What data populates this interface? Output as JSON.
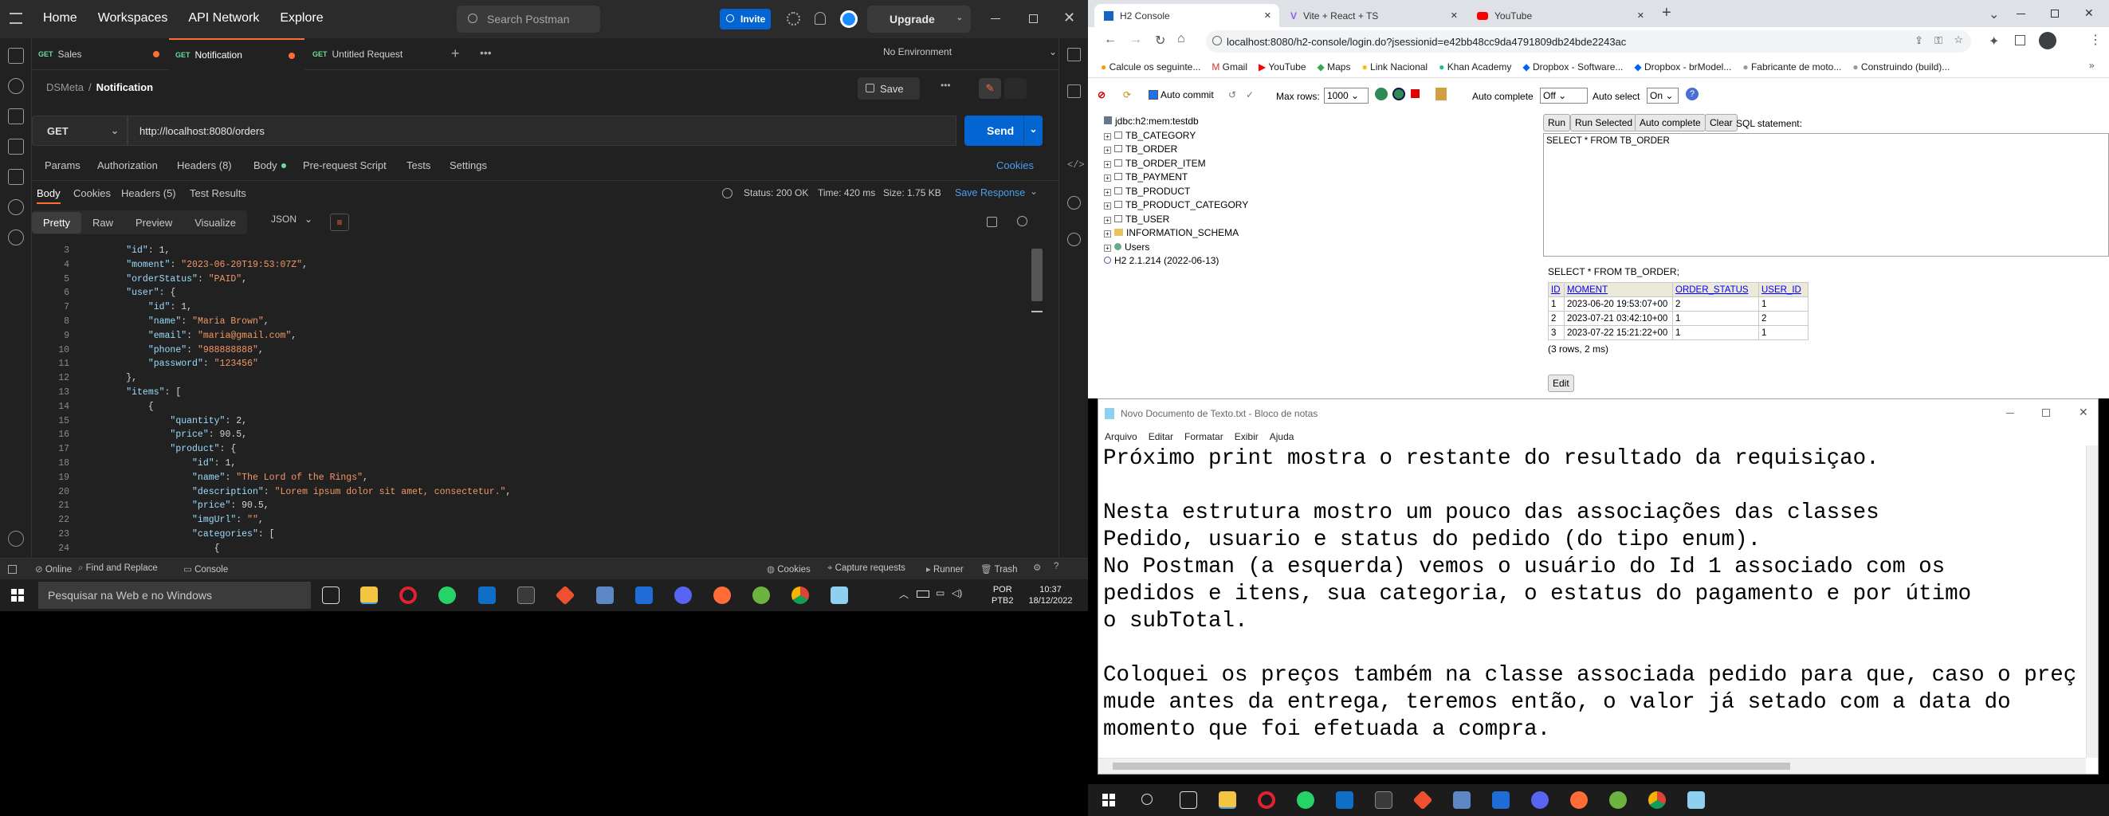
{
  "postman": {
    "nav": [
      "Home",
      "Workspaces",
      "API Network",
      "Explore"
    ],
    "search_placeholder": "Search Postman",
    "invite": "Invite",
    "upgrade": "Upgrade",
    "tabs": [
      {
        "method": "GET",
        "name": "Sales"
      },
      {
        "method": "GET",
        "name": "Notification"
      },
      {
        "method": "GET",
        "name": "Untitled Request"
      }
    ],
    "environment": "No Environment",
    "breadcrumb_parent": "DSMeta",
    "breadcrumb_current": "Notification",
    "save": "Save",
    "method": "GET",
    "url": "http://localhost:8080/orders",
    "send": "Send",
    "request_tabs": [
      "Params",
      "Authorization",
      "Headers (8)",
      "Body",
      "Pre-request Script",
      "Tests",
      "Settings"
    ],
    "cookies": "Cookies",
    "response_tabs": [
      "Body",
      "Cookies",
      "Headers (5)",
      "Test Results"
    ],
    "status": "Status: 200 OK",
    "time": "Time: 420 ms",
    "size": "Size: 1.75 KB",
    "save_response": "Save Response",
    "format_tabs": [
      "Pretty",
      "Raw",
      "Preview",
      "Visualize"
    ],
    "format": "JSON",
    "code_lines": [
      {
        "n": "3",
        "t": "        \"id\": 1,"
      },
      {
        "n": "4",
        "t": "        \"moment\": \"2023-06-20T19:53:07Z\","
      },
      {
        "n": "5",
        "t": "        \"orderStatus\": \"PAID\","
      },
      {
        "n": "6",
        "t": "        \"user\": {"
      },
      {
        "n": "7",
        "t": "            \"id\": 1,"
      },
      {
        "n": "8",
        "t": "            \"name\": \"Maria Brown\","
      },
      {
        "n": "9",
        "t": "            \"email\": \"maria@gmail.com\","
      },
      {
        "n": "10",
        "t": "            \"phone\": \"988888888\","
      },
      {
        "n": "11",
        "t": "            \"password\": \"123456\""
      },
      {
        "n": "12",
        "t": "        },"
      },
      {
        "n": "13",
        "t": "        \"items\": ["
      },
      {
        "n": "14",
        "t": "            {"
      },
      {
        "n": "15",
        "t": "                \"quantity\": 2,"
      },
      {
        "n": "16",
        "t": "                \"price\": 90.5,"
      },
      {
        "n": "17",
        "t": "                \"product\": {"
      },
      {
        "n": "18",
        "t": "                    \"id\": 1,"
      },
      {
        "n": "19",
        "t": "                    \"name\": \"The Lord of the Rings\","
      },
      {
        "n": "20",
        "t": "                    \"description\": \"Lorem ipsum dolor sit amet, consectetur.\","
      },
      {
        "n": "21",
        "t": "                    \"price\": 90.5,"
      },
      {
        "n": "22",
        "t": "                    \"imgUrl\": \"\","
      },
      {
        "n": "23",
        "t": "                    \"categories\": ["
      },
      {
        "n": "24",
        "t": "                        {"
      }
    ],
    "status_bar": [
      "Online",
      "Find and Replace",
      "Console",
      "Cookies",
      "Capture requests",
      "Runner",
      "Trash"
    ]
  },
  "taskbar": {
    "search_placeholder": "Pesquisar na Web e no Windows",
    "lang": "POR",
    "lang2": "PTB2",
    "time": "10:37",
    "date": "18/12/2022"
  },
  "chrome": {
    "tabs": [
      "H2 Console",
      "Vite + React + TS",
      "YouTube"
    ],
    "url": "localhost:8080/h2-console/login.do?jsessionid=e42bb48cc9da4791809db24bde2243ac",
    "bookmarks": [
      "Calcule os seguinte...",
      "Gmail",
      "YouTube",
      "Maps",
      "Link Nacional",
      "Khan Academy",
      "Dropbox - Software...",
      "Dropbox - brModel...",
      "Fabricante de moto...",
      "Construindo (build)..."
    ]
  },
  "h2": {
    "auto_commit": "Auto commit",
    "max_rows_label": "Max rows:",
    "max_rows": "1000",
    "auto_complete_label": "Auto complete",
    "auto_complete": "Off",
    "auto_select_label": "Auto select",
    "auto_select": "On",
    "tree": [
      "jdbc:h2:mem:testdb",
      "TB_CATEGORY",
      "TB_ORDER",
      "TB_ORDER_ITEM",
      "TB_PAYMENT",
      "TB_PRODUCT",
      "TB_PRODUCT_CATEGORY",
      "TB_USER",
      "INFORMATION_SCHEMA",
      "Users",
      "H2 2.1.214 (2022-06-13)"
    ],
    "buttons": [
      "Run",
      "Run Selected",
      "Auto complete",
      "Clear"
    ],
    "sql_label": "SQL statement:",
    "sql": "SELECT * FROM TB_ORDER",
    "result_query": "SELECT * FROM TB_ORDER;",
    "columns": [
      "ID",
      "MOMENT",
      "ORDER_STATUS",
      "USER_ID"
    ],
    "rows": [
      [
        "1",
        "2023-06-20 19:53:07+00",
        "2",
        "1"
      ],
      [
        "2",
        "2023-07-21 03:42:10+00",
        "1",
        "2"
      ],
      [
        "3",
        "2023-07-22 15:21:22+00",
        "1",
        "1"
      ]
    ],
    "summary": "(3 rows, 2 ms)",
    "edit": "Edit"
  },
  "notepad": {
    "title": "Novo Documento de Texto.txt - Bloco de notas",
    "menu": [
      "Arquivo",
      "Editar",
      "Formatar",
      "Exibir",
      "Ajuda"
    ],
    "lines": [
      "Próximo print mostra o restante do resultado da requisiçao.",
      "",
      "Nesta estrutura mostro um pouco das associações das classes",
      "Pedido, usuario e status do pedido (do tipo enum).",
      "No Postman (a esquerda) vemos o usuário do Id 1 associado com os",
      "pedidos e itens, sua categoria, o estatus do pagamento e por útimo",
      "o subTotal.",
      "",
      "Coloquei os preços também na classe associada pedido para que, caso o preço",
      "mude antes da entrega, teremos então, o valor já setado com a data do",
      "momento que foi efetuada a compra."
    ]
  }
}
